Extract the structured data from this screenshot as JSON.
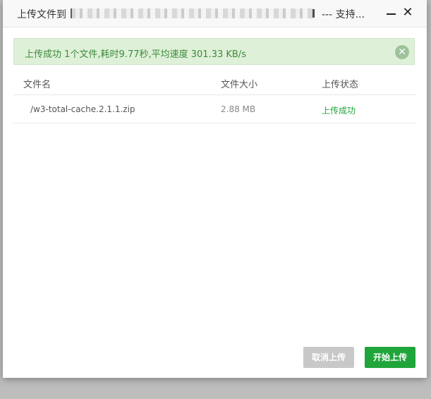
{
  "window": {
    "title_prefix": "上传文件到",
    "title_suffix": "--- 支持...",
    "minimize_label": "",
    "close_label": "✕"
  },
  "alert": {
    "message": "上传成功 1个文件,耗时9.77秒,平均速度 301.33 KB/s",
    "close_label": "✕"
  },
  "table": {
    "headers": {
      "name": "文件名",
      "size": "文件大小",
      "status": "上传状态"
    },
    "rows": [
      {
        "name": "/w3-total-cache.2.1.1.zip",
        "size": "2.88 MB",
        "status": "上传成功"
      }
    ]
  },
  "footer": {
    "cancel_label": "取消上传",
    "start_label": "开始上传"
  },
  "colors": {
    "success": "#20a53a",
    "alert_bg": "#dff0d8",
    "alert_text": "#3c8a3c",
    "disabled": "#c8c8c8"
  }
}
